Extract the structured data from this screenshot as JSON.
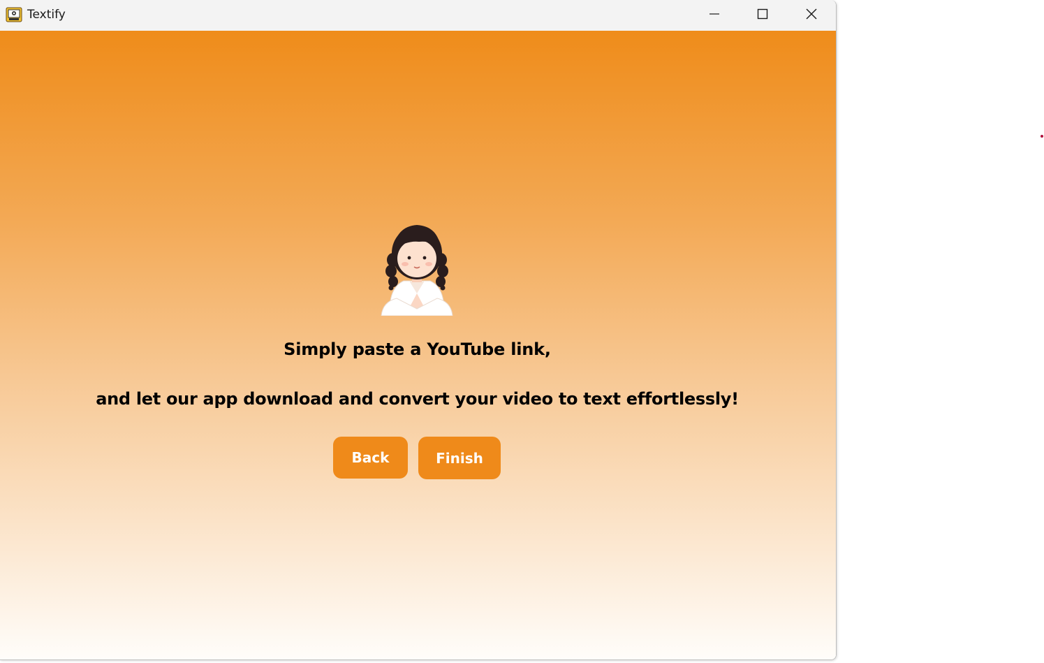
{
  "window": {
    "title": "Textify",
    "controls": {
      "minimize": "minimize-icon",
      "maximize": "maximize-icon",
      "close": "close-icon"
    }
  },
  "main": {
    "illustration": "girl-greeting-avatar",
    "line1": "Simply paste a YouTube link,",
    "line2": "and let our app download and convert your video to text effortlessly!",
    "back_label": "Back",
    "finish_label": "Finish"
  },
  "colors": {
    "gradient_top": "#ef8c1a",
    "gradient_bottom": "#fffdfa",
    "button_bg": "#ef8a1a",
    "button_text": "#ffffff",
    "text": "#000000"
  }
}
